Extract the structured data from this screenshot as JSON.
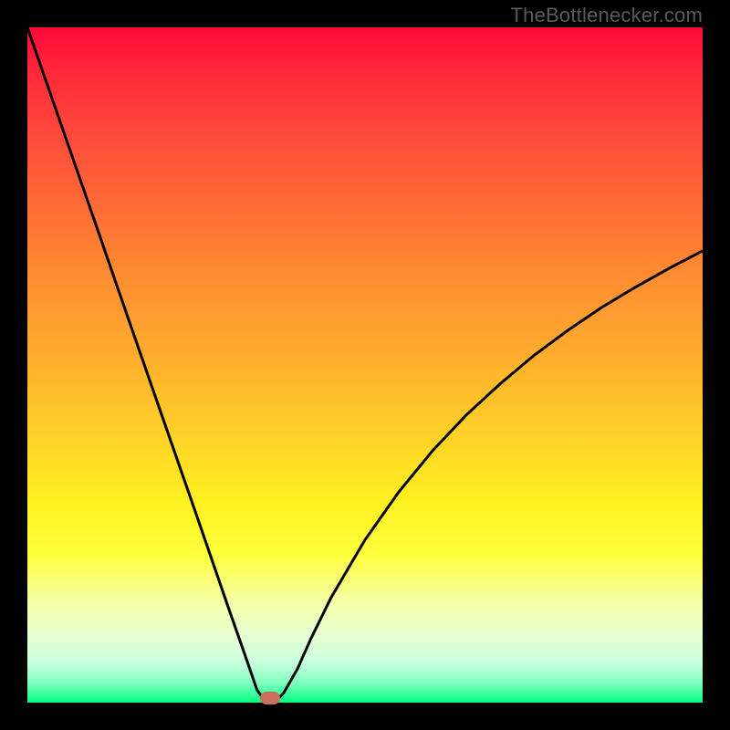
{
  "watermark_text": "TheBottlenecker.com",
  "colors": {
    "background": "#000000",
    "gradient_top": "#ff0a3a",
    "gradient_bottom": "#00ff7f",
    "curve": "#000000",
    "marker": "#cc6f5f",
    "watermark": "#5a5a5a"
  },
  "chart_data": {
    "type": "line",
    "title": "",
    "xlabel": "",
    "ylabel": "",
    "xlim": [
      0,
      100
    ],
    "ylim": [
      0,
      100
    ],
    "annotations": [
      "TheBottlenecker.com"
    ],
    "series": [
      {
        "name": "bottleneck-curve",
        "x": [
          0,
          5,
          10,
          15,
          20,
          25,
          30,
          32,
          34,
          35,
          36,
          37,
          38,
          40,
          42,
          45,
          50,
          55,
          60,
          65,
          70,
          75,
          80,
          85,
          90,
          95,
          100
        ],
        "y": [
          100,
          85.6,
          71.2,
          56.7,
          42.3,
          27.9,
          13.4,
          7.7,
          1.9,
          0.5,
          0.0,
          0.4,
          1.5,
          5.0,
          9.5,
          15.6,
          24.1,
          31.2,
          37.3,
          42.6,
          47.2,
          51.4,
          55.1,
          58.5,
          61.5,
          64.3,
          66.9
        ]
      },
      {
        "name": "minimum-marker",
        "x": [
          36
        ],
        "y": [
          0
        ]
      }
    ]
  }
}
